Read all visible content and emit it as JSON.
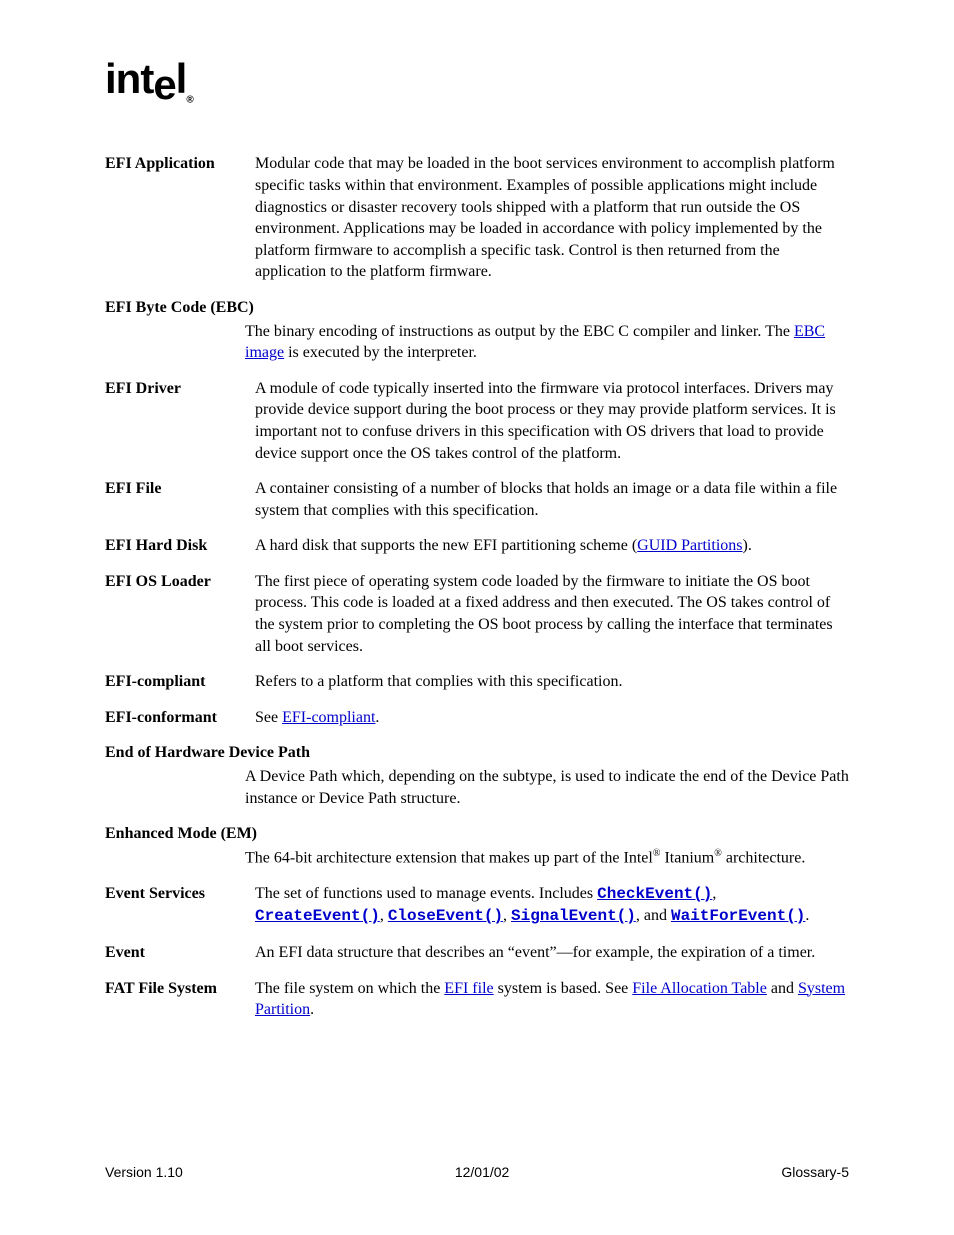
{
  "logo": "intel",
  "entries": [
    {
      "term": "EFI Application",
      "def_pre": "Modular code that may be loaded in the boot services environment to accomplish platform specific tasks within that environment.  Examples of possible applications might include diagnostics or disaster recovery tools shipped with a platform that run outside the OS environment.  Applications may be loaded in accordance with policy implemented by the platform firmware to accomplish a specific task.  Control is then returned from the application to the platform firmware."
    },
    {
      "term": "EFI Byte Code (EBC)",
      "stacked": true,
      "def_pre": "The binary encoding of instructions as output by the EBC C compiler and linker. The ",
      "link1": "EBC image",
      "def_post": " is executed by the interpreter."
    },
    {
      "term": "EFI Driver",
      "def_pre": "A module of code typically inserted into the firmware via protocol interfaces. Drivers may provide device support during the boot process or they may provide platform services.  It is important not to confuse drivers in this specification with OS drivers that load to provide device support once the OS takes control of the platform."
    },
    {
      "term": "EFI File",
      "def_pre": "A container consisting of a number of blocks that holds an image or a data file within a file system that complies with this specification."
    },
    {
      "term": "EFI Hard Disk",
      "def_pre": "A hard disk that supports the new EFI partitioning scheme (",
      "link1": "GUID Partitions",
      "def_post": ")."
    },
    {
      "term": "EFI OS Loader",
      "def_pre": "The first piece of operating system code loaded by the firmware to initiate the OS boot process.  This code is loaded at a fixed address and then executed.  The OS takes control of the system prior to completing the OS boot process by calling the interface that terminates all boot services."
    },
    {
      "term": "EFI-compliant",
      "def_pre": "Refers to a platform that complies with this specification."
    },
    {
      "term": "EFI-conformant",
      "def_pre": "See ",
      "link1": "EFI-compliant",
      "def_post": "."
    },
    {
      "term": "End of Hardware Device Path",
      "stacked": true,
      "def_pre": "A Device Path which, depending on the subtype, is used to indicate the end of the Device Path instance or Device Path structure."
    },
    {
      "term": "Enhanced Mode (EM)",
      "stacked": true,
      "def_pre": "The 64-bit architecture extension that makes up part of the Intel",
      "sup1": "®",
      "mid1": " Itanium",
      "sup2": "®",
      "def_post": " architecture."
    },
    {
      "term": "Event Services",
      "def_pre": "The set of functions used to manage events.  Includes ",
      "code1": "CheckEvent()",
      "mid1": ", ",
      "code2": "CreateEvent()",
      "mid2": ", ",
      "code3": "CloseEvent()",
      "mid3": ", ",
      "code4": "SignalEvent()",
      "mid4": ", and ",
      "code5": "WaitForEvent()",
      "def_post": "."
    },
    {
      "term": "Event",
      "def_pre": "An EFI data structure that describes an “event”—for example, the expiration of a timer."
    },
    {
      "term": "FAT File System",
      "def_pre": "The file system on which the ",
      "link1": "EFI file",
      "mid1": " system is based.  See ",
      "link2": "File Allocation Table",
      "mid2": " and ",
      "link3": "System Partition",
      "def_post": "."
    }
  ],
  "footer": {
    "left": "Version 1.10",
    "center": "12/01/02",
    "right": "Glossary-5"
  }
}
